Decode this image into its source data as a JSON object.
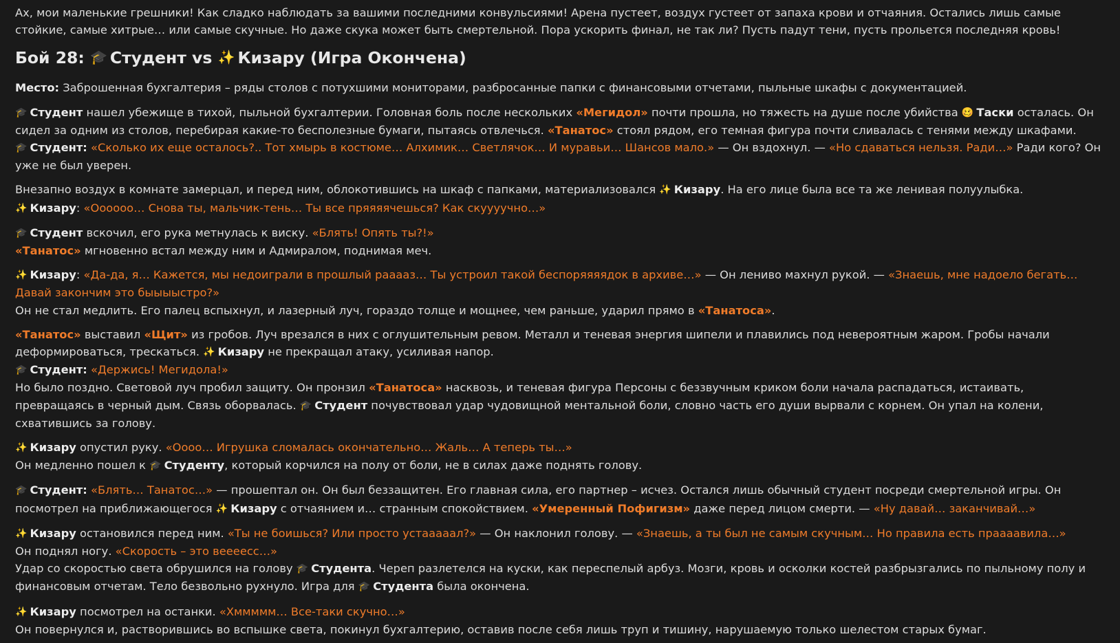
{
  "colors": {
    "background": "#1a1a1a",
    "text": "#dcdcdc",
    "quote": "#f07c2a",
    "bold": "#ececec"
  },
  "icons": {
    "student": "graduation-cap-icon",
    "kizaru": "sparkles-icon",
    "taski": "dizzy-face-icon"
  },
  "blocks": [
    {
      "type": "p",
      "segs": [
        {
          "t": "Ах, мои маленькие грешники! Как сладко наблюдать за вашими последними конвульсиями! Арена пустеет, воздух густеет от запаха крови и отчаяния. Остались лишь самые стойкие, самые хитрые… или самые скучные. Но даже скука может быть смертельной. Пора ускорить финал, не так ли? Пусть падут тени, пусть прольется последняя кровь!"
        }
      ]
    },
    {
      "type": "h",
      "segs": [
        {
          "t": "Бой 28: "
        },
        {
          "i": "cap"
        },
        {
          "t": "Студент vs "
        },
        {
          "i": "spark"
        },
        {
          "t": "Кизару (Игра Окончена)"
        }
      ]
    },
    {
      "type": "p",
      "segs": [
        {
          "t": "Место:",
          "s": "b"
        },
        {
          "t": " Заброшенная бухгалтерия – ряды столов с потухшими мониторами, разбросанные папки с финансовыми отчетами, пыльные шкафы с документацией."
        }
      ]
    },
    {
      "type": "p",
      "segs": [
        {
          "i": "cap"
        },
        {
          "t": "Студент",
          "s": "b"
        },
        {
          "t": " нашел убежище в тихой, пыльной бухгалтерии. Головная боль после нескольких "
        },
        {
          "t": "«Мегидол»",
          "s": "qb"
        },
        {
          "t": " почти прошла, но тяжесть на душе после убийства "
        },
        {
          "i": "face"
        },
        {
          "t": "Таски",
          "s": "b"
        },
        {
          "t": " осталась. Он сидел за одним из столов, перебирая какие-то бесполезные бумаги, пытаясь отвлечься. "
        },
        {
          "t": "«Танатос»",
          "s": "qb"
        },
        {
          "t": " стоял рядом, его темная фигура почти сливалась с тенями между шкафами."
        },
        {
          "br": true
        },
        {
          "i": "cap"
        },
        {
          "t": "Студент:",
          "s": "b"
        },
        {
          "t": " "
        },
        {
          "t": "«Сколько их еще осталось?.. Тот хмырь в костюме… Алхимик… Светлячок… И муравьи… Шансов мало.»",
          "s": "q"
        },
        {
          "t": " — Он вздохнул. — "
        },
        {
          "t": "«Но сдаваться нельзя. Ради…»",
          "s": "q"
        },
        {
          "t": " Ради кого? Он уже не был уверен."
        }
      ]
    },
    {
      "type": "p",
      "segs": [
        {
          "t": "Внезапно воздух в комнате замерцал, и перед ним, облокотившись на шкаф с папками, материализовался "
        },
        {
          "i": "spark"
        },
        {
          "t": "Кизару",
          "s": "b"
        },
        {
          "t": ". На его лице была все та же ленивая полуулыбка."
        },
        {
          "br": true
        },
        {
          "i": "spark"
        },
        {
          "t": "Кизару",
          "s": "b"
        },
        {
          "t": ": "
        },
        {
          "t": "«Оооооо… Снова ты, мальчик-тень… Ты все пряяяячешься? Как скуууучно…»",
          "s": "q"
        }
      ]
    },
    {
      "type": "p",
      "segs": [
        {
          "i": "cap"
        },
        {
          "t": "Студент",
          "s": "b"
        },
        {
          "t": " вскочил, его рука метнулась к виску. "
        },
        {
          "t": "«Блять! Опять ты?!»",
          "s": "q"
        },
        {
          "br": true
        },
        {
          "t": "«Танатос»",
          "s": "qb"
        },
        {
          "t": " мгновенно встал между ним и Адмиралом, поднимая меч."
        }
      ]
    },
    {
      "type": "p",
      "segs": [
        {
          "i": "spark"
        },
        {
          "t": "Кизару",
          "s": "b"
        },
        {
          "t": ": "
        },
        {
          "t": "«Да-да, я… Кажется, мы недоиграли в прошлый рааааз… Ты устроил такой беспоряяяядок в архиве…»",
          "s": "q"
        },
        {
          "t": " — Он лениво махнул рукой. — "
        },
        {
          "t": "«Знаешь, мне надоело бегать… Давай закончим это быыыыстро?»",
          "s": "q"
        },
        {
          "br": true
        },
        {
          "t": "Он не стал медлить. Его палец вспыхнул, и лазерный луч, гораздо толще и мощнее, чем раньше, ударил прямо в "
        },
        {
          "t": "«Танатоса»",
          "s": "qb"
        },
        {
          "t": "."
        }
      ]
    },
    {
      "type": "p",
      "segs": [
        {
          "t": "«Танатос»",
          "s": "qb"
        },
        {
          "t": " выставил "
        },
        {
          "t": "«Щит»",
          "s": "qb"
        },
        {
          "t": " из гробов. Луч врезался в них с оглушительным ревом. Металл и теневая энергия шипели и плавились под невероятным жаром. Гробы начали деформироваться, трескаться. "
        },
        {
          "i": "spark"
        },
        {
          "t": "Кизару",
          "s": "b"
        },
        {
          "t": " не прекращал атаку, усиливая напор."
        },
        {
          "br": true
        },
        {
          "i": "cap"
        },
        {
          "t": "Студент:",
          "s": "b"
        },
        {
          "t": " "
        },
        {
          "t": "«Держись! Мегидола!»",
          "s": "q"
        },
        {
          "br": true
        },
        {
          "t": "Но было поздно. Световой луч пробил защиту. Он пронзил "
        },
        {
          "t": "«Танатоса»",
          "s": "qb"
        },
        {
          "t": " насквозь, и теневая фигура Персоны с беззвучным криком боли начала распадаться, истаивать, превращаясь в черный дым. Связь оборвалась. "
        },
        {
          "i": "cap"
        },
        {
          "t": "Студент",
          "s": "b"
        },
        {
          "t": " почувствовал удар чудовищной ментальной боли, словно часть его души вырвали с корнем. Он упал на колени, схватившись за голову."
        }
      ]
    },
    {
      "type": "p",
      "segs": [
        {
          "i": "spark"
        },
        {
          "t": "Кизару",
          "s": "b"
        },
        {
          "t": " опустил руку. "
        },
        {
          "t": "«Оооо… Игрушка сломалась окончательно… Жаль… А теперь ты…»",
          "s": "q"
        },
        {
          "br": true
        },
        {
          "t": "Он медленно пошел к "
        },
        {
          "i": "cap"
        },
        {
          "t": "Студенту",
          "s": "b"
        },
        {
          "t": ", который корчился на полу от боли, не в силах даже поднять голову."
        }
      ]
    },
    {
      "type": "p",
      "segs": [
        {
          "i": "cap"
        },
        {
          "t": "Студент:",
          "s": "b"
        },
        {
          "t": " "
        },
        {
          "t": "«Блять… Танатос…»",
          "s": "q"
        },
        {
          "t": " — прошептал он. Он был беззащитен. Его главная сила, его партнер – исчез. Остался лишь обычный студент посреди смертельной игры. Он посмотрел на приближающегося "
        },
        {
          "i": "spark"
        },
        {
          "t": "Кизару",
          "s": "b"
        },
        {
          "t": " с отчаянием и… странным спокойствием. "
        },
        {
          "t": "«Умеренный Пофигизм»",
          "s": "qb"
        },
        {
          "t": " даже перед лицом смерти. — "
        },
        {
          "t": "«Ну давай… заканчивай…»",
          "s": "q"
        }
      ]
    },
    {
      "type": "p",
      "segs": [
        {
          "i": "spark"
        },
        {
          "t": "Кизару",
          "s": "b"
        },
        {
          "t": " остановился перед ним. "
        },
        {
          "t": "«Ты не боишься? Или просто устааааал?»",
          "s": "q"
        },
        {
          "t": " — Он наклонил голову. — "
        },
        {
          "t": "«Знаешь, а ты был не самым скучным… Но правила есть праааавила…»",
          "s": "q"
        },
        {
          "br": true
        },
        {
          "t": "Он поднял ногу. "
        },
        {
          "t": "«Скорость – это веееесс…»",
          "s": "q"
        },
        {
          "br": true
        },
        {
          "t": "Удар со скоростью света обрушился на голову "
        },
        {
          "i": "cap"
        },
        {
          "t": "Студента",
          "s": "b"
        },
        {
          "t": ". Череп разлетелся на куски, как переспелый арбуз. Мозги, кровь и осколки костей разбрызгались по пыльному полу и финансовым отчетам. Тело безвольно рухнуло. Игра для "
        },
        {
          "i": "cap"
        },
        {
          "t": "Студента",
          "s": "b"
        },
        {
          "t": " была окончена."
        }
      ]
    },
    {
      "type": "p",
      "segs": [
        {
          "i": "spark"
        },
        {
          "t": "Кизару",
          "s": "b"
        },
        {
          "t": " посмотрел на останки. "
        },
        {
          "t": "«Хммммм… Все-таки скучно…»",
          "s": "q"
        },
        {
          "br": true
        },
        {
          "t": "Он повернулся и, растворившись во вспышке света, покинул бухгалтерию, оставив после себя лишь труп и тишину, нарушаемую только шелестом старых бумаг."
        }
      ]
    }
  ]
}
